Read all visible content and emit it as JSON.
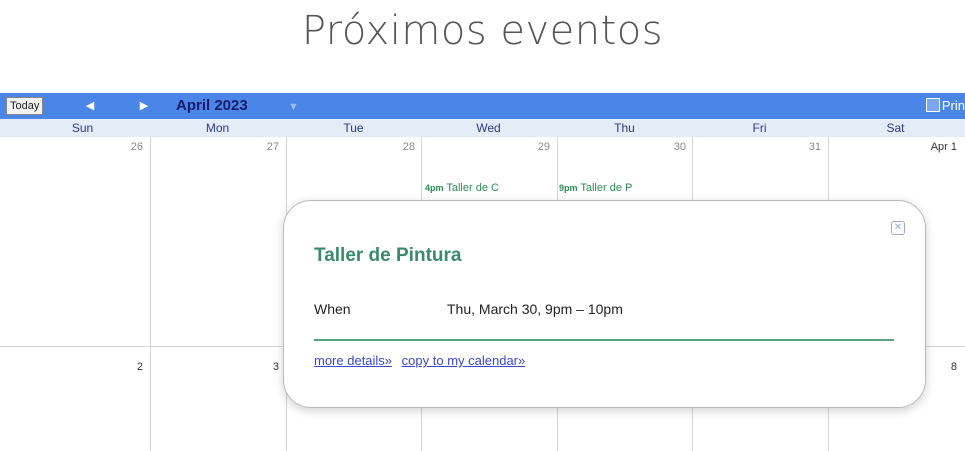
{
  "page": {
    "title": "Próximos eventos"
  },
  "toolbar": {
    "today_label": "Today",
    "prev_icon": "◀",
    "next_icon": "▶",
    "month_title": "April 2023",
    "month_caret": "▼",
    "print_label": "Prin",
    "accent": "#4a86e8"
  },
  "days_of_week": [
    "Sun",
    "Mon",
    "Tue",
    "Wed",
    "Thu",
    "Fri",
    "Sat"
  ],
  "weeks": [
    [
      "26",
      "27",
      "28",
      "29",
      "30",
      "31",
      "Apr 1"
    ],
    [
      "2",
      "3",
      "",
      "",
      "",
      "",
      "8"
    ]
  ],
  "events": [
    {
      "time": "4pm",
      "title": "Taller de C"
    },
    {
      "time": "9pm",
      "title": "Taller de P"
    }
  ],
  "popup": {
    "title": "Taller de Pintura",
    "when_label": "When",
    "when_value": "Thu, March 30, 9pm – 10pm",
    "more_details": "more details»",
    "copy_link": "copy to my calendar»",
    "close_icon": "✕"
  }
}
